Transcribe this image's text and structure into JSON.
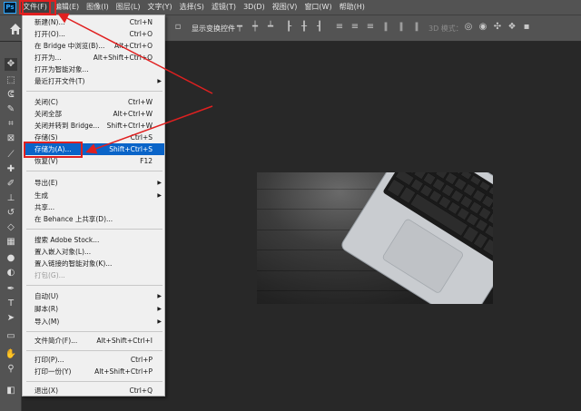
{
  "app": {
    "logo_text": "Ps"
  },
  "menubar": {
    "items": [
      "文件(F)",
      "编辑(E)",
      "图像(I)",
      "图层(L)",
      "文字(Y)",
      "选择(S)",
      "滤镜(T)",
      "3D(D)",
      "视图(V)",
      "窗口(W)",
      "帮助(H)"
    ]
  },
  "options_bar": {
    "show_transform_controls": "显示变换控件",
    "mode_3d": "3D 模式："
  },
  "file_menu": {
    "items": [
      {
        "label": "新建(N)...",
        "shortcut": "Ctrl+N"
      },
      {
        "label": "打开(O)...",
        "shortcut": "Ctrl+O"
      },
      {
        "label": "在 Bridge 中浏览(B)...",
        "shortcut": "Alt+Ctrl+O"
      },
      {
        "label": "打开为...",
        "shortcut": "Alt+Shift+Ctrl+O"
      },
      {
        "label": "打开为智能对象...",
        "shortcut": ""
      },
      {
        "label": "最近打开文件(T)",
        "shortcut": ""
      },
      {
        "label": "关闭(C)",
        "shortcut": "Ctrl+W"
      },
      {
        "label": "关闭全部",
        "shortcut": "Alt+Ctrl+W"
      },
      {
        "label": "关闭并转到 Bridge...",
        "shortcut": "Shift+Ctrl+W"
      },
      {
        "label": "存储(S)",
        "shortcut": "Ctrl+S"
      },
      {
        "label": "存储为(A)...",
        "shortcut": "Shift+Ctrl+S"
      },
      {
        "label": "恢复(V)",
        "shortcut": "F12"
      },
      {
        "label": "导出(E)",
        "shortcut": ""
      },
      {
        "label": "生成",
        "shortcut": ""
      },
      {
        "label": "共享...",
        "shortcut": ""
      },
      {
        "label": "在 Behance 上共享(D)...",
        "shortcut": ""
      },
      {
        "label": "搜索 Adobe Stock...",
        "shortcut": ""
      },
      {
        "label": "置入嵌入对象(L)...",
        "shortcut": ""
      },
      {
        "label": "置入链接的智能对象(K)...",
        "shortcut": ""
      },
      {
        "label": "打包(G)...",
        "shortcut": ""
      },
      {
        "label": "自动(U)",
        "shortcut": ""
      },
      {
        "label": "脚本(R)",
        "shortcut": ""
      },
      {
        "label": "导入(M)",
        "shortcut": ""
      },
      {
        "label": "文件简介(F)...",
        "shortcut": "Alt+Shift+Ctrl+I"
      },
      {
        "label": "打印(P)...",
        "shortcut": "Ctrl+P"
      },
      {
        "label": "打印一份(Y)",
        "shortcut": "Alt+Shift+Ctrl+P"
      },
      {
        "label": "退出(X)",
        "shortcut": "Ctrl+Q"
      }
    ]
  },
  "icons": {
    "home": "home-icon",
    "tools": [
      "move-tool-icon",
      "marquee-tool-icon",
      "lasso-tool-icon",
      "quick-select-icon",
      "crop-tool-icon",
      "frame-tool-icon",
      "eyedropper-icon",
      "healing-brush-icon",
      "brush-tool-icon",
      "clone-stamp-icon",
      "history-brush-icon",
      "eraser-icon",
      "gradient-icon",
      "blur-icon",
      "dodge-icon",
      "pen-tool-icon",
      "type-tool-icon",
      "path-select-icon",
      "rectangle-tool-icon",
      "hand-tool-icon",
      "zoom-tool-icon",
      "color-swatch-icon"
    ]
  },
  "colors": {
    "highlight": "#0a64c8",
    "annotation": "#e02020"
  }
}
